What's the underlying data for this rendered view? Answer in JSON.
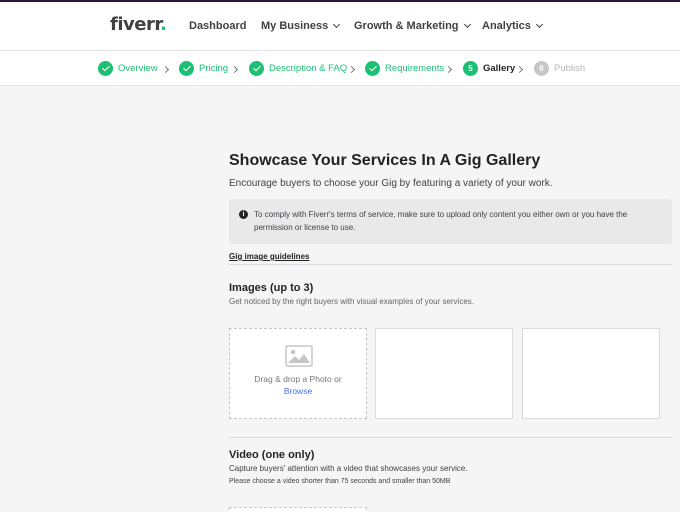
{
  "header": {
    "logo_text": "fiverr",
    "logo_dot": ".",
    "nav": [
      {
        "label": "Dashboard",
        "has_dropdown": false
      },
      {
        "label": "My Business",
        "has_dropdown": true
      },
      {
        "label": "Growth & Marketing",
        "has_dropdown": true
      },
      {
        "label": "Analytics",
        "has_dropdown": true
      }
    ]
  },
  "steps": [
    {
      "label": "Overview",
      "state": "complete",
      "icon": "check-icon"
    },
    {
      "label": "Pricing",
      "state": "complete",
      "icon": "check-icon"
    },
    {
      "label": "Description & FAQ",
      "state": "complete",
      "icon": "check-icon"
    },
    {
      "label": "Requirements",
      "state": "complete",
      "icon": "check-icon"
    },
    {
      "label": "Gallery",
      "state": "active",
      "number": "5"
    },
    {
      "label": "Publish",
      "state": "inactive",
      "number": "6"
    }
  ],
  "main": {
    "title": "Showcase Your Services In A Gig Gallery",
    "subtitle": "Encourage buyers to choose your Gig by featuring a variety of your work.",
    "notice": {
      "icon": "info-icon",
      "icon_glyph": "i",
      "text": "To comply with Fiverr's terms of service, make sure to upload only content you either own or you have the permission or license to use."
    },
    "guidelines_link": "Gig image guidelines",
    "images": {
      "heading": "Images (up to 3)",
      "description": "Get noticed by the right buyers with visual examples of your services.",
      "drop_text": "Drag & drop a Photo or",
      "browse_text": "Browse"
    },
    "video": {
      "heading": "Video (one only)",
      "description": "Capture buyers' attention with a video that showcases your service.",
      "note": "Please choose a video shorter than 75 seconds and smaller than 50MB"
    }
  },
  "colors": {
    "brand_green": "#1dbf73",
    "link_blue": "#446ee7",
    "top_bar": "#2b1b3a"
  }
}
